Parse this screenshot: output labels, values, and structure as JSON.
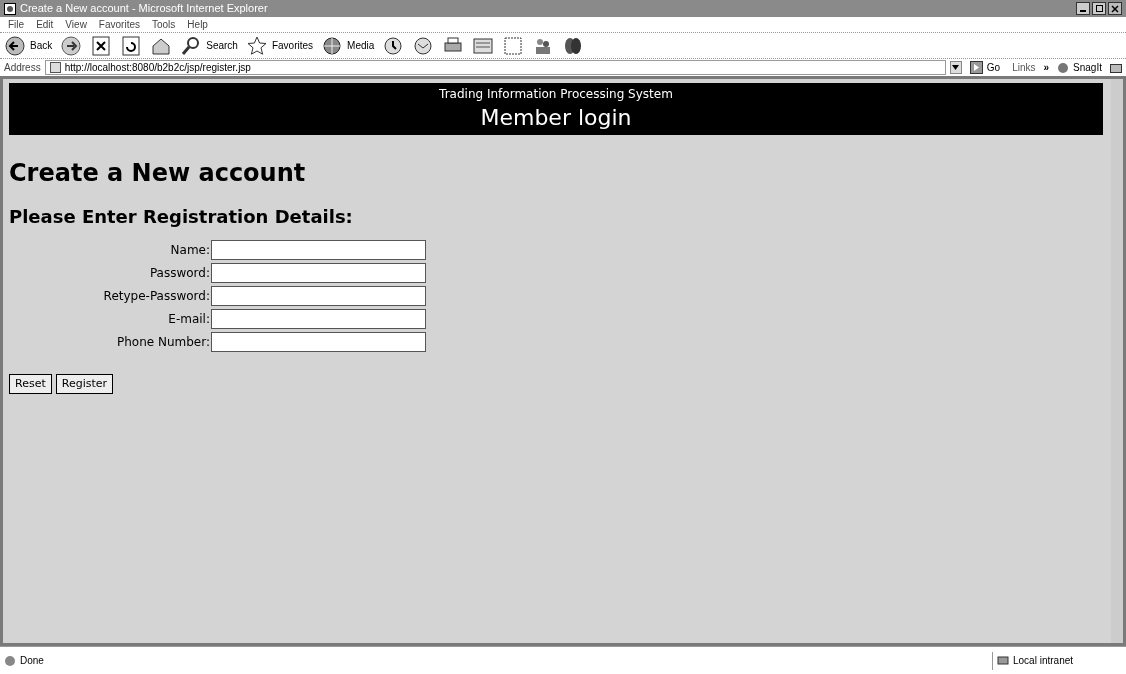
{
  "window": {
    "title": "Create a New account - Microsoft Internet Explorer"
  },
  "menu": [
    "File",
    "Edit",
    "View",
    "Favorites",
    "Tools",
    "Help"
  ],
  "toolbar": [
    {
      "kind": "back",
      "label": "Back"
    },
    {
      "kind": "forward"
    },
    {
      "kind": "stop"
    },
    {
      "kind": "refresh"
    },
    {
      "kind": "home"
    },
    {
      "kind": "search",
      "label": "Search"
    },
    {
      "kind": "favorites",
      "label": "Favorites"
    },
    {
      "kind": "media",
      "label": "Media"
    },
    {
      "kind": "history"
    },
    {
      "kind": "mail"
    },
    {
      "kind": "print"
    },
    {
      "kind": "edit"
    },
    {
      "kind": "discuss"
    },
    {
      "kind": "messenger"
    },
    {
      "kind": "msn"
    }
  ],
  "address_bar": {
    "label": "Address",
    "url": "http://localhost:8080/b2b2c/jsp/register.jsp",
    "go": "Go",
    "links": "Links",
    "links_more": "»",
    "snagit": "SnagIt"
  },
  "banner": {
    "subtitle": "Trading Information Processing System",
    "title": "Member login"
  },
  "heading": "Create a New account",
  "subheading": "Please Enter Registration Details:",
  "fields": [
    {
      "label": "Name:"
    },
    {
      "label": "Password:"
    },
    {
      "label": "Retype-Password:"
    },
    {
      "label": "E-mail:"
    },
    {
      "label": "Phone Number:"
    }
  ],
  "buttons": [
    "Reset",
    "Register"
  ],
  "status_bar": {
    "status": "Done",
    "zone": "Local intranet"
  }
}
